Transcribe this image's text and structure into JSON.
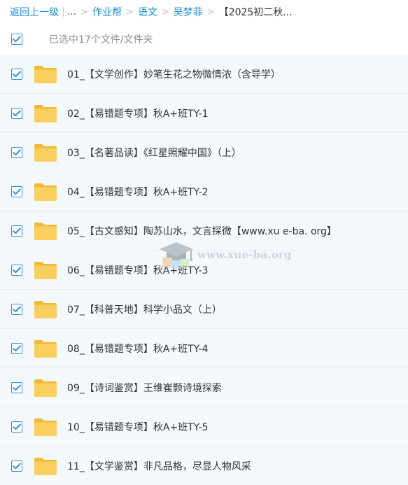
{
  "breadcrumb": {
    "back_label": "返回上一级",
    "ellipsis": "...",
    "items": [
      "作业帮",
      "语文",
      "吴梦菲"
    ],
    "current": "【2025初二秋...",
    "separator": ">",
    "pipe": "|"
  },
  "selection": {
    "summary": "已选中17个文件/文件夹",
    "checked": true
  },
  "files": [
    {
      "name": "01_【文学创作】妙笔生花之物微情浓（含导学）",
      "checked": true
    },
    {
      "name": "02_【易错题专项】秋A+班TY-1",
      "checked": true
    },
    {
      "name": "03_【名著品读】《红星照耀中国》（上）",
      "checked": true
    },
    {
      "name": "04_【易错题专项】秋A+班TY-2",
      "checked": true
    },
    {
      "name": "05_【古文感知】陶苏山水，文言探微【www.xu e-ba. org】",
      "checked": true
    },
    {
      "name": "06_【易错题专项】秋A+班TY-3",
      "checked": true
    },
    {
      "name": "07_【科普天地】科学小品文（上）",
      "checked": true
    },
    {
      "name": "08_【易错题专项】秋A+班TY-4",
      "checked": true
    },
    {
      "name": "09_【诗词鉴赏】王维崔颢诗境探索",
      "checked": true
    },
    {
      "name": "10_【易错题专项】秋A+班TY-5",
      "checked": true
    },
    {
      "name": "11_【文学鉴赏】非凡品格，尽显人物风采",
      "checked": true
    }
  ],
  "watermark": {
    "text": "www.xue-ba.org"
  },
  "colors": {
    "accent": "#2f8fdc",
    "link": "#1a8cd8",
    "row_bg": "#f3f9fd",
    "folder": "#f7c94e"
  },
  "icons": {
    "checkbox": "checkbox-checked-icon",
    "folder": "folder-icon",
    "watermark": "graduation-cap-icon"
  }
}
